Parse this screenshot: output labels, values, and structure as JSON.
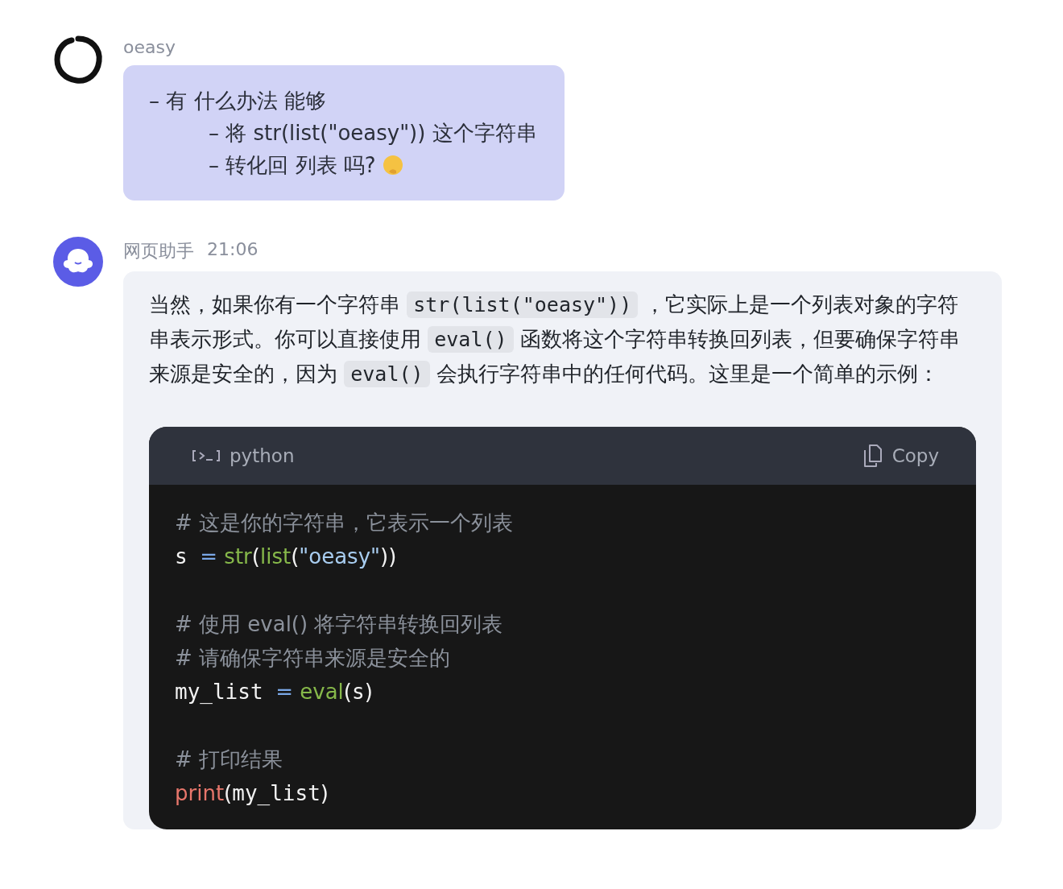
{
  "messages": [
    {
      "kind": "user",
      "author": "oeasy",
      "lines": [
        {
          "text": "– 有 什么办法 能够",
          "children": [
            {
              "text": "– 将 str(list(\"oeasy\")) 这个字符串"
            },
            {
              "text": "– 转化回 列表 吗?",
              "emoji": true
            }
          ]
        }
      ]
    },
    {
      "kind": "assistant",
      "author": "网页助手",
      "time": "21:06",
      "paragraph": [
        {
          "kind": "text",
          "text": "当然，如果你有一个字符串 "
        },
        {
          "kind": "code",
          "text": "str(list(\"oeasy\"))"
        },
        {
          "kind": "text",
          "text": " ，它实际上是一个列表对象的字符串表示形式。你可以直接使用 "
        },
        {
          "kind": "code",
          "text": "eval()"
        },
        {
          "kind": "text",
          "text": " 函数将这个字符串转换回列表，但要确保字符串来源是安全的，因为 "
        },
        {
          "kind": "code",
          "text": "eval()"
        },
        {
          "kind": "text",
          "text": " 会执行字符串中的任何代码。这里是一个简单的示例："
        }
      ],
      "code_block": {
        "language": "python",
        "copy_label": "Copy",
        "lines": [
          {
            "kind": "code",
            "tokens": [
              {
                "kind": "comment",
                "text": "# 这是你的字符串，它表示一个列表"
              }
            ]
          },
          {
            "kind": "code",
            "tokens": [
              {
                "kind": "name",
                "text": "s "
              },
              {
                "kind": "op",
                "text": "="
              },
              {
                "kind": "func",
                "text": " str"
              },
              {
                "kind": "punct",
                "text": "("
              },
              {
                "kind": "func",
                "text": "list"
              },
              {
                "kind": "punct",
                "text": "("
              },
              {
                "kind": "string",
                "text": "\"oeasy\""
              },
              {
                "kind": "punct",
                "text": "))"
              }
            ]
          },
          {
            "kind": "blank"
          },
          {
            "kind": "code",
            "tokens": [
              {
                "kind": "comment",
                "text": "# 使用 eval() 将字符串转换回列表"
              }
            ]
          },
          {
            "kind": "code",
            "tokens": [
              {
                "kind": "comment",
                "text": "# 请确保字符串来源是安全的"
              }
            ]
          },
          {
            "kind": "code",
            "tokens": [
              {
                "kind": "name",
                "text": "my_list "
              },
              {
                "kind": "op",
                "text": "="
              },
              {
                "kind": "func",
                "text": " eval"
              },
              {
                "kind": "punct",
                "text": "("
              },
              {
                "kind": "name",
                "text": "s"
              },
              {
                "kind": "punct",
                "text": ")"
              }
            ]
          },
          {
            "kind": "blank"
          },
          {
            "kind": "code",
            "tokens": [
              {
                "kind": "comment",
                "text": "# 打印结果"
              }
            ]
          },
          {
            "kind": "code",
            "tokens": [
              {
                "kind": "builtin",
                "text": "print"
              },
              {
                "kind": "punct",
                "text": "("
              },
              {
                "kind": "name",
                "text": "my_list"
              },
              {
                "kind": "punct",
                "text": ")"
              }
            ]
          }
        ]
      }
    }
  ]
}
